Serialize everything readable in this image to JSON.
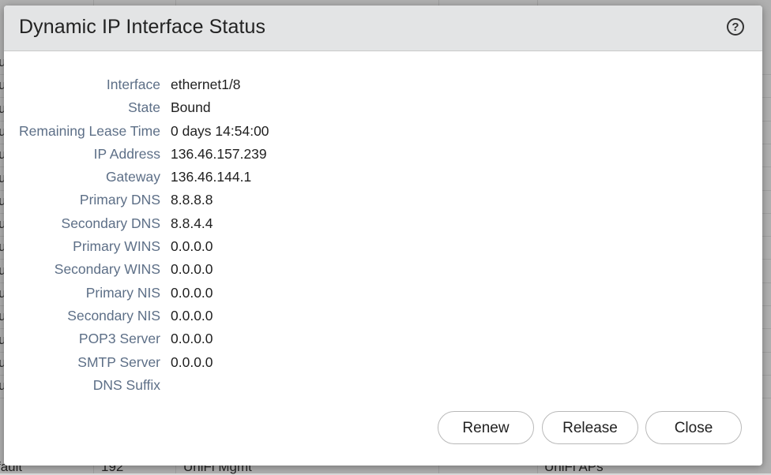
{
  "dialog": {
    "title": "Dynamic IP Interface Status",
    "help_label": "?"
  },
  "fields": [
    {
      "label": "Interface",
      "value": "ethernet1/8"
    },
    {
      "label": "State",
      "value": "Bound"
    },
    {
      "label": "Remaining Lease Time",
      "value": "0 days 14:54:00"
    },
    {
      "label": "IP Address",
      "value": "136.46.157.239"
    },
    {
      "label": "Gateway",
      "value": "136.46.144.1"
    },
    {
      "label": "Primary DNS",
      "value": "8.8.8.8"
    },
    {
      "label": "Secondary DNS",
      "value": "8.8.4.4"
    },
    {
      "label": "Primary WINS",
      "value": "0.0.0.0"
    },
    {
      "label": "Secondary WINS",
      "value": "0.0.0.0"
    },
    {
      "label": "Primary NIS",
      "value": "0.0.0.0"
    },
    {
      "label": "Secondary NIS",
      "value": "0.0.0.0"
    },
    {
      "label": "POP3 Server",
      "value": "0.0.0.0"
    },
    {
      "label": "SMTP Server",
      "value": "0.0.0.0"
    },
    {
      "label": "DNS Suffix",
      "value": ""
    }
  ],
  "buttons": {
    "renew": "Renew",
    "release": "Release",
    "close": "Close"
  },
  "background": {
    "edge_glyphs": [
      "u",
      "u",
      "u",
      "u",
      "u",
      "u",
      "u",
      "u",
      "u",
      "u",
      "u",
      "u",
      "u",
      "u",
      "u"
    ],
    "last_row": {
      "col1": "fault",
      "col2": "192",
      "col3": "UniFi Mgmt",
      "col4": "UniFi APs"
    }
  }
}
